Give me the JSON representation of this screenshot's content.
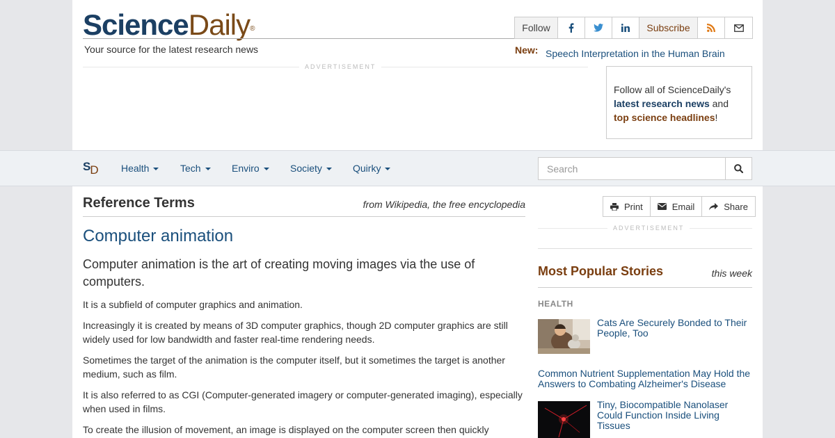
{
  "header": {
    "logo_science": "Science",
    "logo_daily": "Daily",
    "logo_reg": "®",
    "tagline": "Your source for the latest research news",
    "follow_label": "Follow",
    "subscribe_label": "Subscribe",
    "social_icons": [
      "facebook-icon",
      "twitter-icon",
      "linkedin-icon",
      "rss-icon",
      "email-icon"
    ],
    "new_label": "New:",
    "new_headline": "Speech Interpretation in the Human Brain",
    "advertisement_label": "ADVERTISEMENT"
  },
  "follow_box": {
    "line1": "Follow all of ScienceDaily's",
    "link1": "latest research news",
    "mid": " and",
    "link2": "top science headlines",
    "end": "!"
  },
  "nav": {
    "mark_s": "S",
    "mark_d": "D",
    "items": [
      "Health",
      "Tech",
      "Enviro",
      "Society",
      "Quirky"
    ],
    "search_placeholder": "Search"
  },
  "main": {
    "section_title": "Reference Terms",
    "source": "from Wikipedia, the free encyclopedia",
    "article_title": "Computer animation",
    "lead": "Computer animation is the art of creating moving images via the use of computers.",
    "paragraphs": [
      "It is a subfield of computer graphics and animation.",
      "Increasingly it is created by means of 3D computer graphics, though 2D computer graphics are still widely used for low bandwidth and faster real-time rendering needs.",
      "Sometimes the target of the animation is the computer itself, but it sometimes the target is another medium, such as film.",
      "It is also referred to as CGI (Computer-generated imagery or computer-generated imaging), especially when used in films.",
      "To create the illusion of movement, an image is displayed on the computer screen then quickly"
    ]
  },
  "rail": {
    "print_label": "Print",
    "email_label": "Email",
    "share_label": "Share",
    "advertisement_label": "ADVERTISEMENT",
    "popular_title": "Most Popular Stories",
    "popular_period": "this week",
    "category": "HEALTH",
    "stories": [
      "Cats Are Securely Bonded to Their People, Too",
      "Common Nutrient Supplementation May Hold the Answers to Combating Alzheimer's Disease",
      "Tiny, Biocompatible Nanolaser Could Function Inside Living Tissues"
    ]
  },
  "colors": {
    "brand_blue": "#1b3f63",
    "brand_brown": "#7a3e10",
    "link_blue": "#1a4f7c"
  }
}
